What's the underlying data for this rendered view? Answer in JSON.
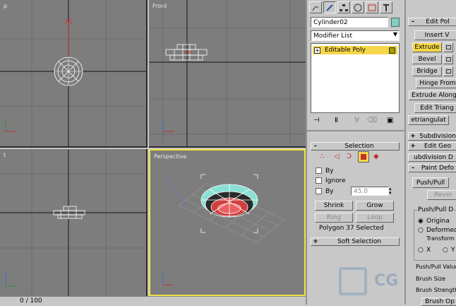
{
  "viewports": {
    "top": {
      "label": "p"
    },
    "front": {
      "label": "Front"
    },
    "left": {
      "label": "t"
    },
    "perspective": {
      "label": "Perspective"
    }
  },
  "status_bar": {
    "frame_counter": "0 / 100"
  },
  "command_panel": {
    "tabs": [
      "create-icon",
      "modify-icon",
      "hierarchy-icon",
      "motion-icon",
      "display-icon",
      "utilities-icon"
    ],
    "object_name": "Cylinder02",
    "object_color": "#7ecfc4",
    "modifier_list_label": "Modifier List",
    "stack_item": "Editable Poly",
    "selection": {
      "title": "Selection",
      "by_label": "By",
      "ignore_label": "Ignore",
      "by_angle_label": "By",
      "angle_value": "45.0",
      "shrink_label": "Shrink",
      "grow_label": "Grow",
      "ring_label": "Ring",
      "loop_label": "Loop",
      "status": "Polygon 37 Selected"
    },
    "soft_selection_title": "Soft Selection"
  },
  "edit_panel": {
    "edit_poly_title": "Edit Pol",
    "insert_label": "Insert V",
    "extrude_label": "Extrude",
    "bevel_label": "Bevel",
    "bridge_label": "Bridge",
    "hinge_label": "Hinge From",
    "extrude_along_label": "Extrude Along",
    "edit_triang_label": "Edit Triang",
    "retriangulate_label": "etriangulat",
    "subdivision_label": "Subdivision",
    "edit_geo_label": "Edit Geo",
    "subdivision_d_label": "ubdivision D",
    "paint_deform_label": "Paint Defo",
    "push_pull_label": "Push/Pull",
    "revert_label": "Rever",
    "push_pull_dir_label": "Push/Pull D",
    "original_label": "Origina",
    "deformed_label": "Deformed",
    "transform_label": "Transform a",
    "x_label": "X",
    "y_label": "Y",
    "push_pull_value_label": "Push/Pull Value",
    "brush_size_label": "Brush Size",
    "brush_strength_label": "Brush Strength",
    "brush_options_label": "Brush Op"
  },
  "watermark": {
    "text": "CG"
  }
}
